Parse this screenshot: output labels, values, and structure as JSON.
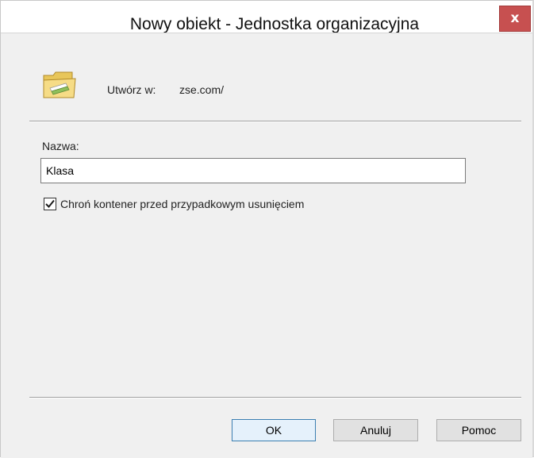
{
  "window": {
    "title": "Nowy obiekt - Jednostka organizacyjna",
    "close_glyph": "x"
  },
  "create_in": {
    "icon": "ou-folder-icon",
    "label": "Utwórz w:",
    "value": "zse.com/"
  },
  "name_field": {
    "label": "Nazwa:",
    "value": "Klasa"
  },
  "protect_checkbox": {
    "checked": true,
    "label": "Chroń kontener przed przypadkowym usunięciem"
  },
  "buttons": {
    "ok": "OK",
    "cancel": "Anuluj",
    "help": "Pomoc"
  },
  "colors": {
    "close_button": "#c75050",
    "default_button_border": "#3c7fb1",
    "dialog_background": "#f0f0f0"
  }
}
